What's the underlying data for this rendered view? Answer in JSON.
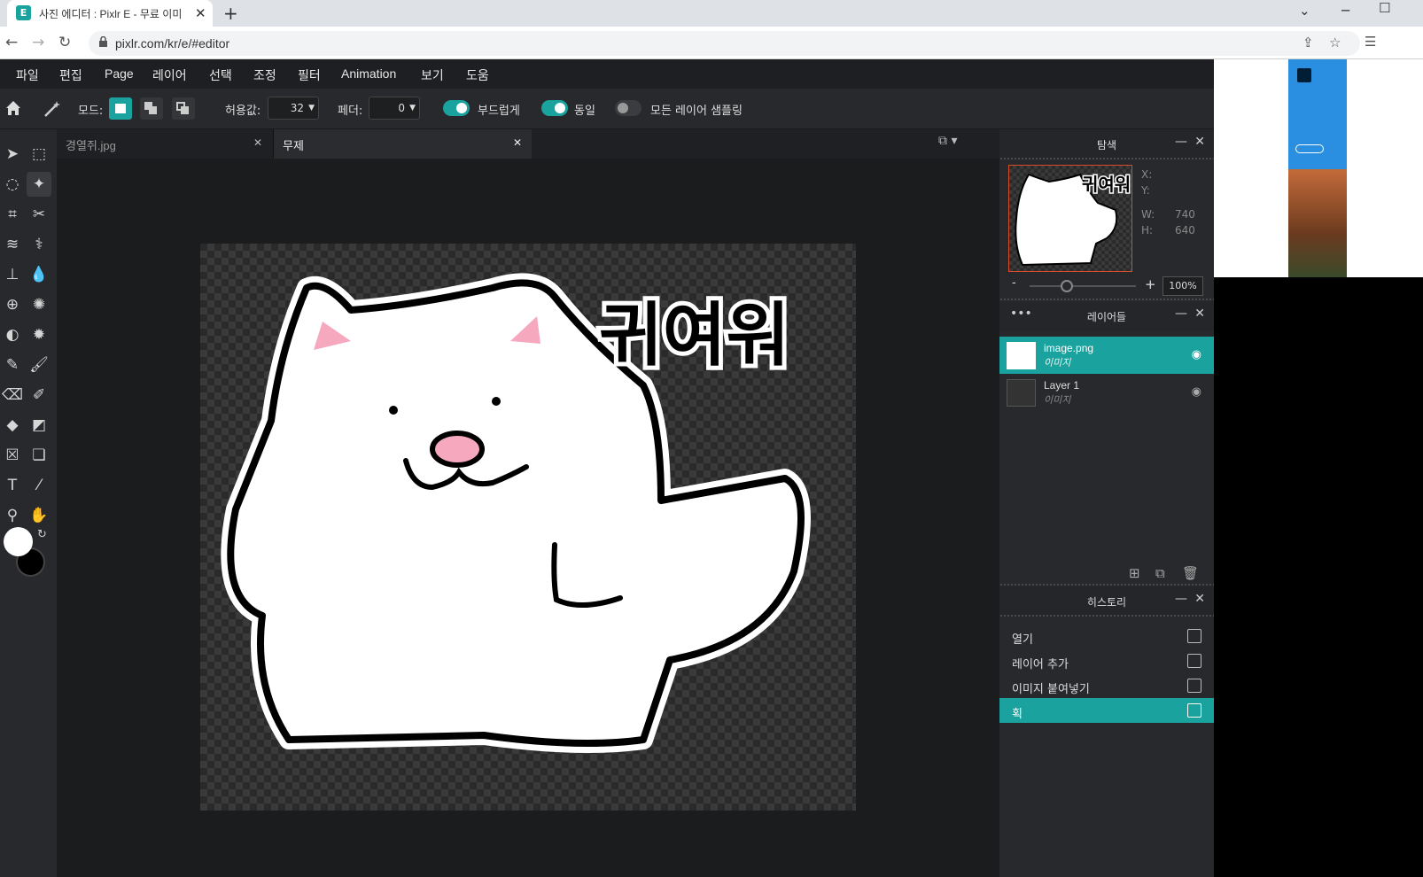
{
  "browser": {
    "tab_title": "사진 에디터 : Pixlr E - 무료 이미",
    "favicon": "E",
    "url": "pixlr.com/kr/e/#editor"
  },
  "menu": [
    "파일",
    "편집",
    "Page",
    "레이어",
    "선택",
    "조정",
    "필터",
    "Animation",
    "보기",
    "도움"
  ],
  "toolbar": {
    "mode_label": "모드:",
    "tolerance_label": "허용값:",
    "tolerance_value": "32",
    "feather_label": "페더:",
    "feather_value": "0",
    "smooth_label": "부드럽게",
    "contiguous_label": "동일",
    "sample_all_label": "모든 레이어 샘플링",
    "smooth_on": true,
    "contiguous_on": true,
    "sample_all_on": false
  },
  "doc_tabs": [
    {
      "name": "경열쥐.jpg",
      "active": false
    },
    {
      "name": "무제",
      "active": true
    }
  ],
  "canvas": {
    "sticker_text": "귀여워"
  },
  "navigator": {
    "title": "탐색",
    "x_label": "X:",
    "y_label": "Y:",
    "w_label": "W:",
    "h_label": "H:",
    "w_value": "740",
    "h_value": "640",
    "zoom": "100%",
    "zoom_minus": "-",
    "zoom_plus": "+",
    "zoom_level_fraction": 0.35
  },
  "layers": {
    "title": "레이어들",
    "items": [
      {
        "name": "image.png",
        "type": "이미지",
        "selected": true
      },
      {
        "name": "Layer 1",
        "type": "이미지",
        "selected": false
      }
    ]
  },
  "history": {
    "title": "히스토리",
    "items": [
      {
        "name": "열기",
        "icon": "document-icon",
        "selected": false
      },
      {
        "name": "레이어 추가",
        "icon": "layer-icon",
        "selected": false
      },
      {
        "name": "이미지 붙여넣기",
        "icon": "image-icon",
        "selected": false
      },
      {
        "name": "획",
        "icon": "document-icon",
        "selected": true
      }
    ]
  },
  "colors": {
    "accent": "#1aa39e",
    "panel": "#27292c",
    "canvas_bg": "#1b1c1e"
  }
}
